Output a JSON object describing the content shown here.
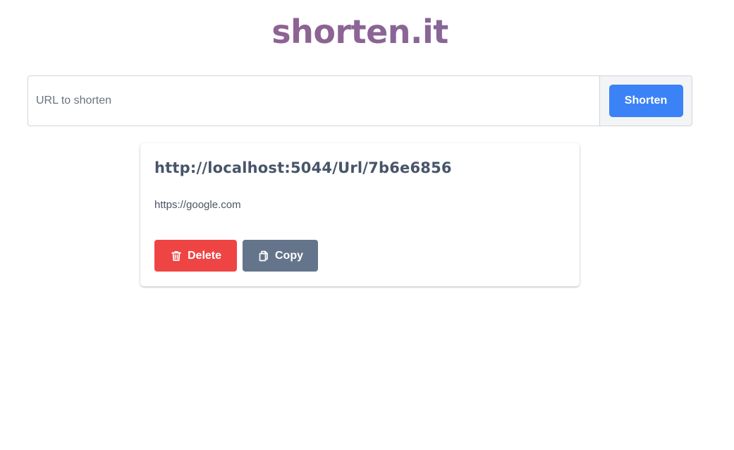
{
  "app": {
    "title": "shorten.it",
    "title_gradient": [
      "#9a5e8c",
      "#7d6a9e"
    ]
  },
  "form": {
    "input_placeholder": "URL to shorten",
    "input_value": "",
    "submit_label": "Shorten",
    "submit_color": "#3b82f6"
  },
  "links": [
    {
      "short_url": "http://localhost:5044/Url/7b6e6856",
      "original_url": "https://google.com",
      "delete_label": "Delete",
      "delete_icon": "trash-icon",
      "delete_color": "#ef4444",
      "copy_label": "Copy",
      "copy_icon": "copy-icon",
      "copy_color": "#64748b"
    }
  ]
}
